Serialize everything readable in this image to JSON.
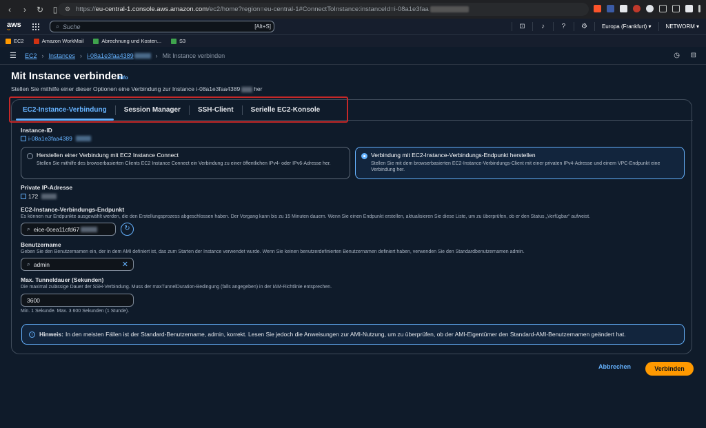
{
  "browser": {
    "url_scheme": "https://",
    "url_host": "eu-central-1.console.aws.amazon.com",
    "url_path": "/ec2/home?region=eu-central-1#ConnectToInstance:instanceId=i-08a1e3faa"
  },
  "aws_nav": {
    "logo_text": "aws",
    "search_placeholder": "Suche",
    "search_shortcut": "[Alt+S]",
    "region": "Europa (Frankfurt) ▾",
    "account": "NETWORM ▾"
  },
  "bookmarks": [
    {
      "label": "EC2",
      "color": "#ff9900"
    },
    {
      "label": "Amazon WorkMail",
      "color": "#d13212"
    },
    {
      "label": "Abrechnung und Kosten...",
      "color": "#3fa34d"
    },
    {
      "label": "S3",
      "color": "#3fa34d"
    }
  ],
  "breadcrumb": {
    "ec2": "EC2",
    "instances": "Instances",
    "instance_id": "i-08a1e3faa4389",
    "current": "Mit Instance verbinden"
  },
  "page": {
    "title": "Mit Instance verbinden",
    "info": "Info",
    "subtitle_pre": "Stellen Sie mithilfe einer dieser Optionen eine Verbindung zur Instance i-08a1e3faa4389",
    "subtitle_post": "her"
  },
  "tabs": [
    {
      "label": "EC2-Instance-Verbindung",
      "active": true
    },
    {
      "label": "Session Manager",
      "active": false
    },
    {
      "label": "SSH-Client",
      "active": false
    },
    {
      "label": "Serielle EC2-Konsole",
      "active": false
    }
  ],
  "instance": {
    "label": "Instance-ID",
    "value": "i-08a1e3faa4389"
  },
  "options": [
    {
      "title": "Herstellen einer Verbindung mit EC2 Instance Connect",
      "desc": "Stellen Sie mithilfe des browserbasierten Clients EC2 Instance Connect ein Verbindung zu einer öffentlichen IPv4- oder IPv6-Adresse her.",
      "selected": false
    },
    {
      "title": "Verbindung mit EC2-Instance-Verbindungs-Endpunkt herstellen",
      "desc": "Stellen Sie mit dem browserbasierten EC2-Instance-Verbindungs-Client mit einer privaten IPv4-Adresse und einem VPC-Endpunkt eine Verbindung her.",
      "selected": true
    }
  ],
  "private_ip": {
    "label": "Private IP-Adresse",
    "value": "172"
  },
  "endpoint": {
    "label": "EC2-Instance-Verbindungs-Endpunkt",
    "desc": "Es können nur Endpunkte ausgewählt werden, die den Erstellungsprozess abgeschlossen haben. Der Vorgang kann bis zu 15 Minuten dauern. Wenn Sie einen Endpunkt erstellen, aktualisieren Sie diese Liste, um zu überprüfen, ob er den Status „Verfügbar“ aufweist.",
    "value": "eice-0cea11cfd67"
  },
  "username": {
    "label": "Benutzername",
    "desc": "Geben Sie den Benutzernamen ein, der in dem AMI definiert ist, das zum Starten der Instance verwendet wurde. Wenn Sie keinen benutzerdefinierten Benutzernamen definiert haben, verwenden Sie den Standardbenutzernamen admin.",
    "value": "admin"
  },
  "tunnel": {
    "label": "Max. Tunneldauer (Sekunden)",
    "desc": "Die maximal zulässige Dauer der SSH-Verbindung. Muss der maxTunnelDuration-Bedingung (falls angegeben) in der IAM-Richtlinie entsprechen.",
    "value": "3600",
    "hint": "Min. 1 Sekunde. Max. 3 600 Sekunden (1 Stunde)."
  },
  "alert": {
    "bold": "Hinweis:",
    "text": "In den meisten Fällen ist der Standard-Benutzername, admin, korrekt. Lesen Sie jedoch die Anweisungen zur AMI-Nutzung, um zu überprüfen, ob der AMI-Eigentümer den Standard-AMI-Benutzernamen geändert hat."
  },
  "actions": {
    "cancel": "Abbrechen",
    "connect": "Verbinden"
  },
  "colors": {
    "accent": "#66b3ff",
    "primary_button": "#ff9900",
    "highlight_box": "#c62828"
  }
}
